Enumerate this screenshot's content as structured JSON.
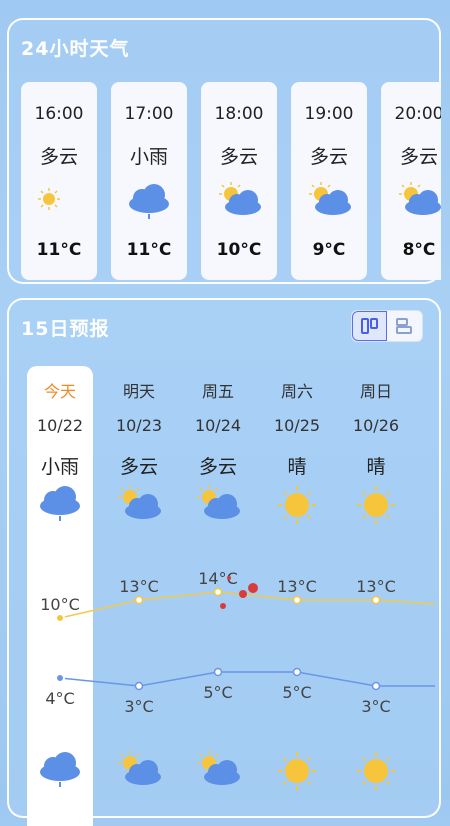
{
  "hourly": {
    "title": "24小时天气",
    "items": [
      {
        "time": "16:00",
        "cond": "多云",
        "temp": "11°C",
        "icon": "sun-small"
      },
      {
        "time": "17:00",
        "cond": "小雨",
        "temp": "11°C",
        "icon": "rain"
      },
      {
        "time": "18:00",
        "cond": "多云",
        "temp": "10°C",
        "icon": "partly-cloudy"
      },
      {
        "time": "19:00",
        "cond": "多云",
        "temp": "9°C",
        "icon": "partly-cloudy"
      },
      {
        "time": "20:00",
        "cond": "多云",
        "temp": "8°C",
        "icon": "partly-cloudy"
      }
    ]
  },
  "daily": {
    "title": "15日预报",
    "days": [
      {
        "name": "今天",
        "date": "10/22",
        "cond": "小雨",
        "icon": "rain",
        "icon2": "rain",
        "high": "10°C",
        "low": "4°C"
      },
      {
        "name": "明天",
        "date": "10/23",
        "cond": "多云",
        "icon": "partly-cloudy",
        "icon2": "partly-cloudy",
        "high": "13°C",
        "low": "3°C"
      },
      {
        "name": "周五",
        "date": "10/24",
        "cond": "多云",
        "icon": "partly-cloudy",
        "icon2": "partly-cloudy",
        "high": "14°C",
        "low": "5°C"
      },
      {
        "name": "周六",
        "date": "10/25",
        "cond": "晴",
        "icon": "sunny",
        "icon2": "sunny",
        "high": "13°C",
        "low": "5°C"
      },
      {
        "name": "周日",
        "date": "10/26",
        "cond": "晴",
        "icon": "sunny",
        "icon2": "sunny",
        "high": "13°C",
        "low": "3°C"
      }
    ]
  },
  "colors": {
    "accent": "#f08a24",
    "high_line": "#f2c94c",
    "low_line": "#6a95e8",
    "toggle_active": "#5b6ef2"
  }
}
